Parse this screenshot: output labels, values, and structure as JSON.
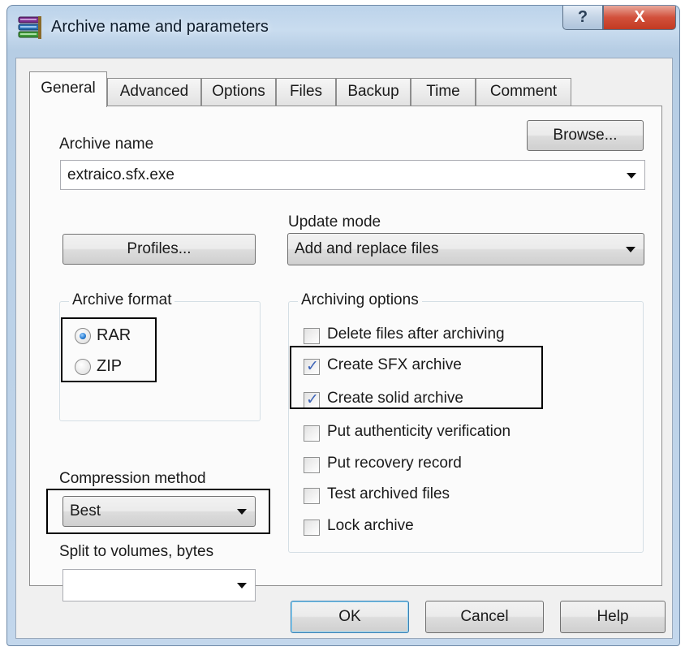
{
  "window": {
    "title": "Archive name and parameters",
    "help_label": "?",
    "close_label": "X"
  },
  "tabs": [
    "General",
    "Advanced",
    "Options",
    "Files",
    "Backup",
    "Time",
    "Comment"
  ],
  "general": {
    "archive_name_label": "Archive name",
    "browse_label": "Browse...",
    "archive_name_value": "extraico.sfx.exe",
    "profiles_label": "Profiles...",
    "update_mode_label": "Update mode",
    "update_mode_value": "Add and replace files",
    "archive_format": {
      "label": "Archive format",
      "options": [
        "RAR",
        "ZIP"
      ],
      "selected": "RAR"
    },
    "compression_label": "Compression method",
    "compression_value": "Best",
    "split_label": "Split to volumes, bytes",
    "split_value": "",
    "archiving_options": {
      "label": "Archiving options",
      "items": [
        {
          "label": "Delete files after archiving",
          "checked": false
        },
        {
          "label": "Create SFX archive",
          "checked": true
        },
        {
          "label": "Create solid archive",
          "checked": true
        },
        {
          "label": "Put authenticity verification",
          "checked": false
        },
        {
          "label": "Put recovery record",
          "checked": false
        },
        {
          "label": "Test archived files",
          "checked": false
        },
        {
          "label": "Lock archive",
          "checked": false
        }
      ]
    }
  },
  "footer": {
    "ok_label": "OK",
    "cancel_label": "Cancel",
    "help_label": "Help"
  },
  "colors": {
    "title_bg": "#bcd3ea",
    "close_red": "#c23a22",
    "checkmark": "#3d64b8",
    "highlight_box": "#000000"
  }
}
